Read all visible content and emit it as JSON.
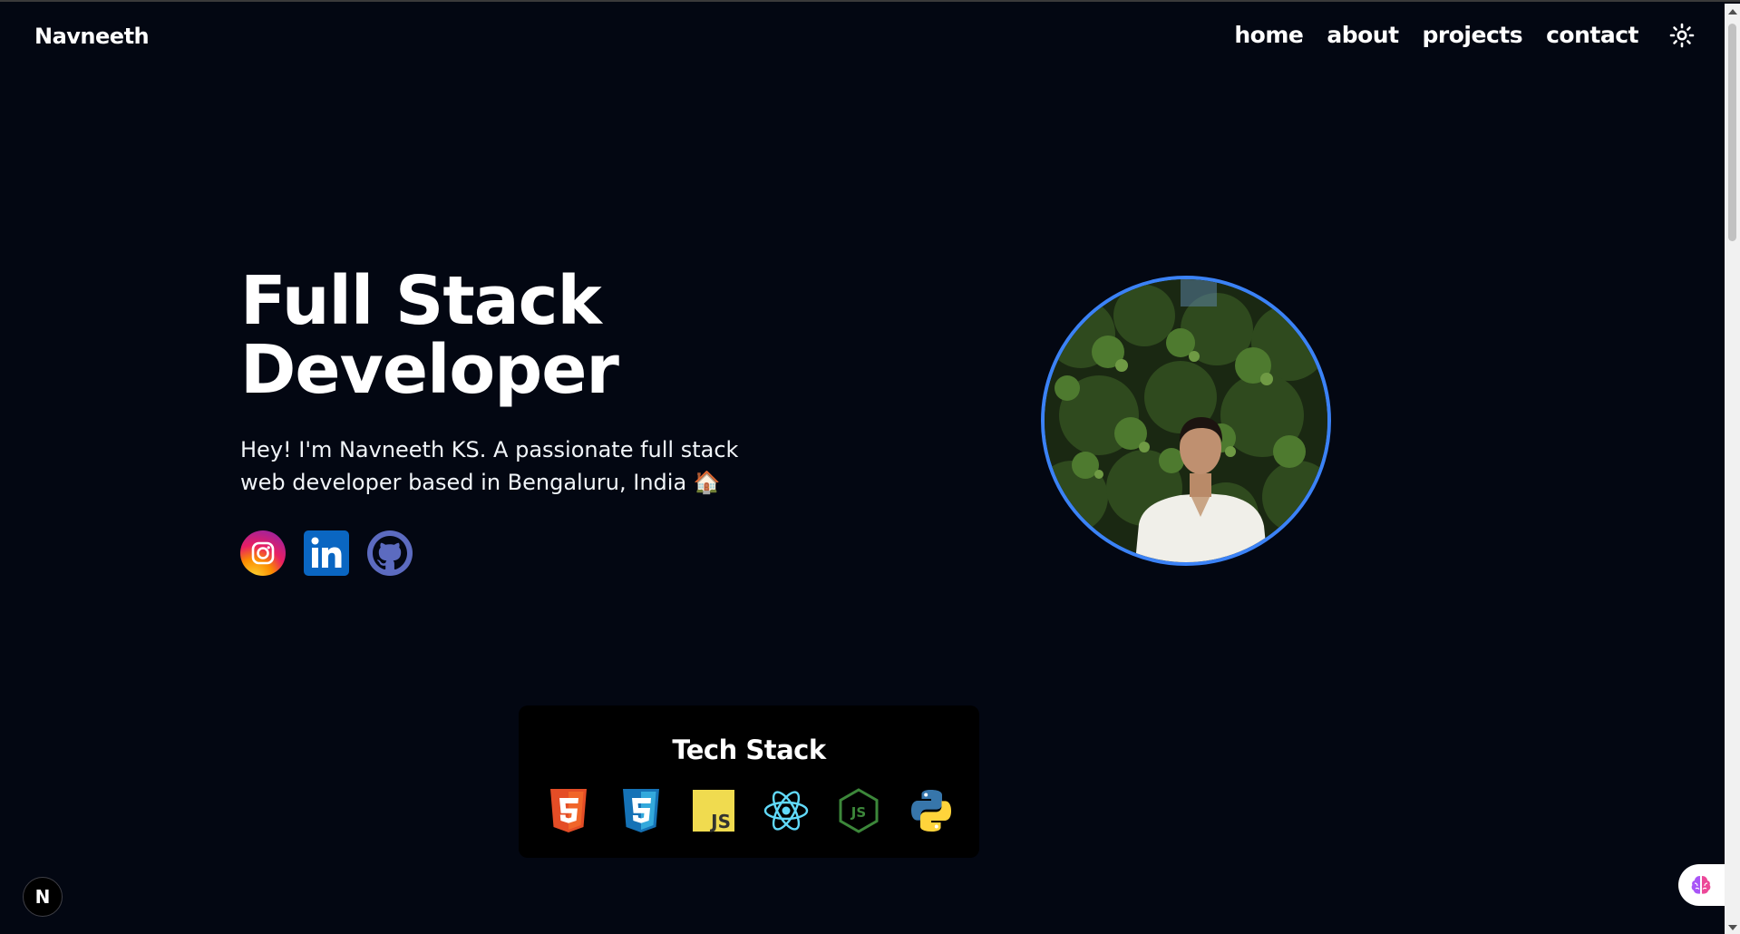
{
  "header": {
    "brand": "Navneeth",
    "nav": [
      {
        "label": "home"
      },
      {
        "label": "about"
      },
      {
        "label": "projects"
      },
      {
        "label": "contact"
      }
    ],
    "theme_icon": "sun-icon"
  },
  "hero": {
    "title_line1": "Full Stack",
    "title_line2": "Developer",
    "description": "Hey! I'm Navneeth KS. A passionate full stack web developer based in Bengaluru, India 🏠",
    "socials": [
      {
        "icon": "instagram-icon"
      },
      {
        "icon": "linkedin-icon"
      },
      {
        "icon": "github-icon"
      }
    ],
    "avatar_border_color": "#3b82f6"
  },
  "tech_stack": {
    "title": "Tech Stack",
    "icons": [
      "html5-icon",
      "css3-icon",
      "javascript-icon",
      "react-icon",
      "nodejs-icon",
      "python-icon"
    ]
  },
  "widgets": {
    "next_badge": "N",
    "extension_icon": "brain-icon"
  },
  "colors": {
    "background": "#030712",
    "accent": "#3b82f6",
    "card": "#000000"
  }
}
